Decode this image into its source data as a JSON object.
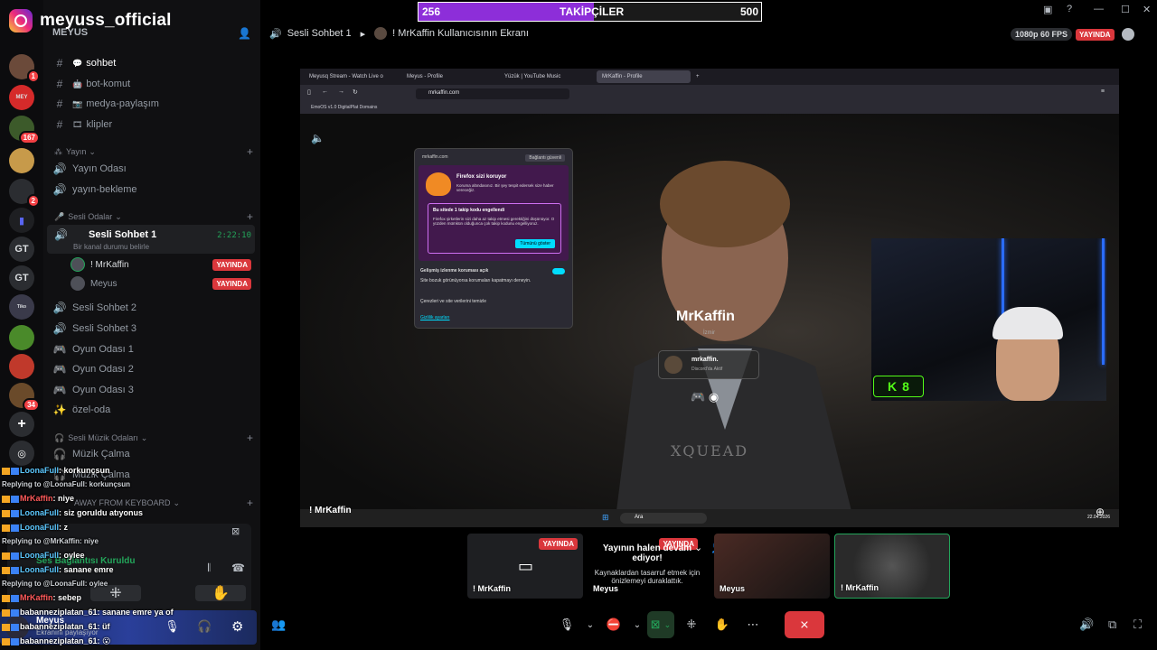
{
  "instagram": {
    "handle": "meyuss_official"
  },
  "follower_goal": {
    "current": "256",
    "label": "TAKİPÇİLER",
    "target": "500",
    "progress": 0.512
  },
  "server": {
    "name": "MEYUS"
  },
  "rail_badges": [
    "1",
    "167",
    "2",
    "34"
  ],
  "rail_labels": [
    "GT",
    "GT"
  ],
  "channels_text": [
    {
      "icon": "#",
      "emoji": "💬",
      "name": "sohbet"
    },
    {
      "icon": "#",
      "emoji": "🤖",
      "name": "bot-komut"
    },
    {
      "icon": "#",
      "emoji": "📷",
      "name": "medya-paylaşım"
    },
    {
      "icon": "#",
      "emoji": "🎞",
      "name": "klipler"
    }
  ],
  "category_yayin": "Yayın",
  "channels_yayin": [
    {
      "name": "Yayın Odası"
    },
    {
      "name": "yayın-bekleme"
    }
  ],
  "category_sesli": "Sesli Odalar",
  "active_room": {
    "name": "Sesli Sohbet 1",
    "status": "Bir kanal durumu belirle",
    "timer": "2:22:10"
  },
  "room_users": [
    {
      "name": "! MrKaffin",
      "badge": "YAYINDA"
    },
    {
      "name": "Meyus",
      "badge": "YAYINDA"
    }
  ],
  "channels_voice": [
    {
      "name": "Sesli Sohbet 2",
      "icon": "🔊"
    },
    {
      "name": "Sesli Sohbet 3",
      "icon": "🔊"
    },
    {
      "name": "Oyun Odası 1",
      "icon": "🎮"
    },
    {
      "name": "Oyun Odası 2",
      "icon": "🎮"
    },
    {
      "name": "Oyun Odası 3",
      "icon": "🎮"
    },
    {
      "name": "özel-oda",
      "icon": "✨"
    }
  ],
  "category_muzik": "Sesli Müzik Odaları",
  "channels_muzik": [
    {
      "name": "Müzik Çalma"
    },
    {
      "name": "Müzik Çalma"
    }
  ],
  "category_afk": "AWAY FROM KEYBOARD",
  "voice_status": "Ses Bağlantısı Kuruldu",
  "user_bar": {
    "name": "Meyus",
    "status": "Ekranını paylaşıyor"
  },
  "chat": [
    {
      "user": "LoonaFull",
      "text": "korkunçsun",
      "color": "blue"
    },
    {
      "reply": "Replying to @LoonaFull: korkunçsun"
    },
    {
      "user": "MrKaffin",
      "text": "niye",
      "color": "red"
    },
    {
      "user": "LoonaFull",
      "text": "siz goruldu atıyonus",
      "color": "blue"
    },
    {
      "user": "LoonaFull",
      "text": "z",
      "color": "blue"
    },
    {
      "reply": "Replying to @MrKaffin: niye"
    },
    {
      "user": "LoonaFull",
      "text": "oylee",
      "color": "blue"
    },
    {
      "user": "LoonaFull",
      "text": "sanane emre",
      "color": "blue"
    },
    {
      "reply": "Replying to @LoonaFull: oylee"
    },
    {
      "user": "MrKaffin",
      "text": "sebep",
      "color": "red"
    },
    {
      "user": "babanneziplatan_61",
      "text": "sanane emre ya of",
      "color": "white"
    },
    {
      "user": "babanneziplatan_61",
      "text": "üf",
      "color": "white"
    },
    {
      "user": "babanneziplatan_61",
      "text": "😮",
      "color": "white"
    }
  ],
  "header": {
    "room": "Sesli Sohbet 1",
    "screen": "! MrKaffin Kullanıcısının Ekranı"
  },
  "quality": {
    "label": "1080p 60 FPS",
    "badge": "YAYINDA"
  },
  "browser": {
    "tabs": [
      "Meyusq Stream - Watch Live o",
      "Meyus - Profile",
      "Yüzük | YouTube Music",
      "MrKaffin - Profile"
    ],
    "url": "mrkaffin.com",
    "bookmarks": "EmoOS v1.0   DigitalPlat Domains"
  },
  "shield_popup": {
    "site": "mrkaffin.com",
    "secure": "Bağlantı güvenli",
    "title": "Firefox sizi koruyor",
    "subtitle": "Koruma altındasınız. Bir şey tespit edersek size haber vereceğiz.",
    "blocked_title": "Bu sitede 1 takip kodu engellendi",
    "blocked_text": "Firefox şirketlerin sizi daha az takip etmesi gerektiğini düşünüyor. O yüzden mümkün olduğunca çok takip kodunu engelliyoruz.",
    "show_all": "Tümünü göster",
    "enhanced": "Gelişmiş izlenme koruması açık",
    "enhanced_sub": "Site bozuk görünüyorsa korumaları kapatmayı deneyin.",
    "cookies": "Çerezleri ve site verilerini temizle",
    "privacy": "Gizlilik ayarları"
  },
  "profile": {
    "name": "MrKaffin",
    "location": "İzmir",
    "discord_name": "mrkaffin.",
    "discord_status": "Discord'da Aktif",
    "watermark": "XQUEAD"
  },
  "kick_count": "8",
  "taskbar": {
    "search": "Ara",
    "date": "22.04.2026"
  },
  "stream_label": "! MrKaffin",
  "tiles": [
    {
      "label": "! MrKaffin",
      "badge": "YAYINDA"
    },
    {
      "label": "Meyus",
      "badge": "YAYINDA"
    },
    {
      "label": "Meyus"
    },
    {
      "label": "! MrKaffin"
    }
  ],
  "paused": {
    "title": "Yayının halen devam ediyor!",
    "text": "Kaynaklardan tasarruf etmek için önizlemeyi duraklattık."
  }
}
